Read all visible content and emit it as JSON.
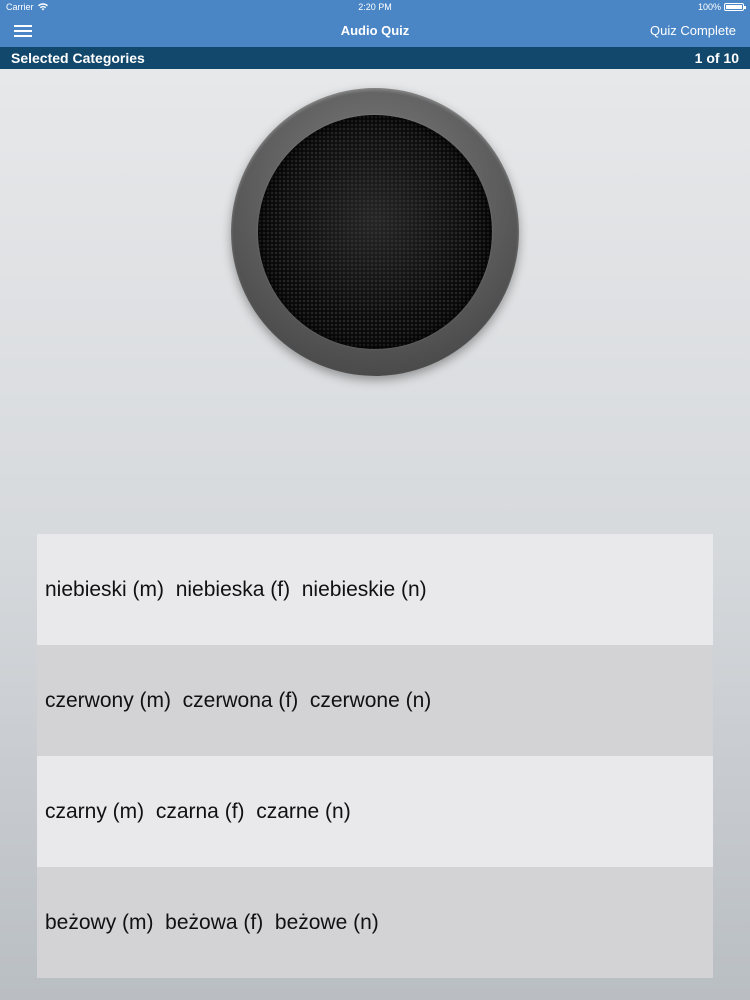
{
  "status_bar": {
    "carrier": "Carrier",
    "time": "2:20 PM",
    "battery": "100%"
  },
  "nav": {
    "title": "Audio Quiz",
    "right_button": "Quiz Complete"
  },
  "category_bar": {
    "label": "Selected Categories",
    "progress": "1 of 10"
  },
  "answers": [
    "niebieski (m)  niebieska (f)  niebieskie (n)",
    "czerwony (m)  czerwona (f)  czerwone (n)",
    "czarny (m)  czarna (f)  czarne (n)",
    "beżowy (m)  beżowa (f)  beżowe (n)"
  ],
  "colors": {
    "nav_background": "#4a86c5",
    "category_background": "#12486b"
  },
  "icons": {
    "menu": "hamburger-menu-icon",
    "wifi": "wifi-icon",
    "battery": "battery-icon",
    "speaker": "speaker-play-icon"
  }
}
